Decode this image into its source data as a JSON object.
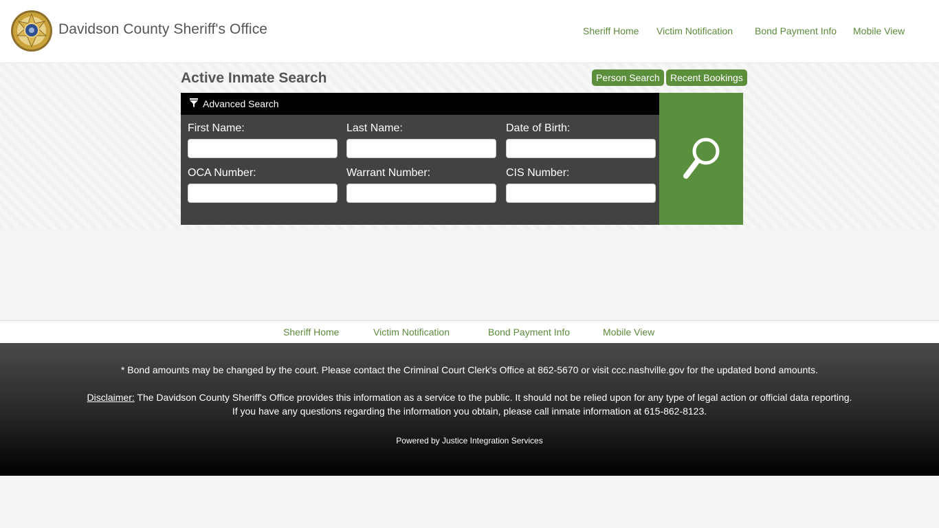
{
  "header": {
    "title": "Davidson County Sheriff's Office",
    "nav": [
      "Sheriff Home",
      "Victim Notification",
      "Bond Payment Info",
      "Mobile View"
    ]
  },
  "search": {
    "page_title": "Active Inmate Search",
    "buttons": {
      "person_search": "Person Search",
      "recent_bookings": "Recent Bookings"
    },
    "advanced_label": "Advanced Search",
    "fields": {
      "first_name": {
        "label": "First Name:",
        "value": ""
      },
      "last_name": {
        "label": "Last Name:",
        "value": ""
      },
      "dob": {
        "label": "Date of Birth:",
        "value": ""
      },
      "oca": {
        "label": "OCA Number:",
        "value": ""
      },
      "warrant": {
        "label": "Warrant Number:",
        "value": ""
      },
      "cis": {
        "label": "CIS Number:",
        "value": ""
      }
    }
  },
  "footer_nav": [
    "Sheriff Home",
    "Victim Notification",
    "Bond Payment Info",
    "Mobile View"
  ],
  "footer": {
    "bond_note": "* Bond amounts may be changed by the court. Please contact the Criminal Court Clerk's Office at 862-5670 or visit ccc.nashville.gov for the updated bond amounts.",
    "disclaimer_label": "Disclaimer:",
    "disclaimer_text": " The Davidson County Sheriff's Office provides this information as a service to the public. It should not be relied upon for any type of legal action or official data reporting.",
    "disclaimer_line2": "If you have any questions regarding the information you obtain, please call inmate information at 615-862-8123.",
    "powered_by": "Powered by Justice Integration Services"
  },
  "colors": {
    "accent_green": "#5b8f3c",
    "link_green": "#5b8a3c",
    "panel_dark": "#424242",
    "logo_gold": "#c9a23a",
    "logo_blue": "#2e4f8e"
  }
}
